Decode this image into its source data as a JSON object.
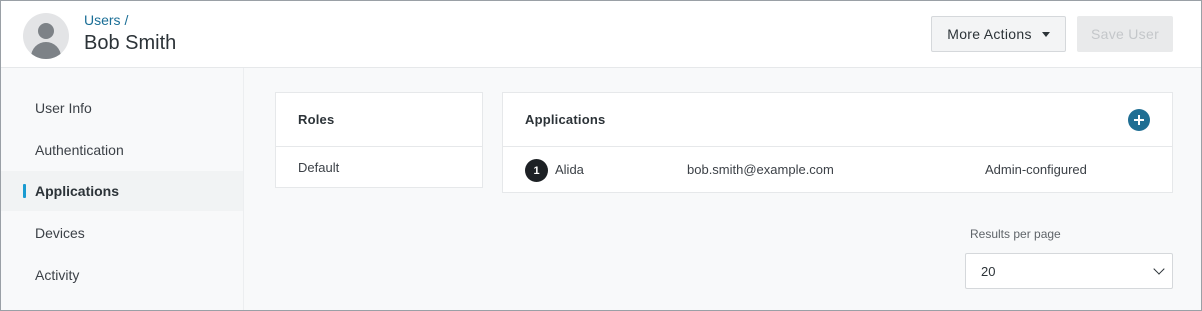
{
  "header": {
    "breadcrumb": "Users",
    "breadcrumb_separator": "/",
    "title": "Bob Smith",
    "more_actions_label": "More Actions",
    "save_label": "Save User",
    "avatar_icon": "user-avatar-icon"
  },
  "sidebar": {
    "items": [
      {
        "label": "User Info",
        "active": false
      },
      {
        "label": "Authentication",
        "active": false
      },
      {
        "label": "Applications",
        "active": true
      },
      {
        "label": "Devices",
        "active": false
      },
      {
        "label": "Activity",
        "active": false
      }
    ]
  },
  "roles": {
    "title": "Roles",
    "items": [
      "Default"
    ]
  },
  "applications": {
    "title": "Applications",
    "add_icon": "plus-icon",
    "rows": [
      {
        "badge": "1",
        "name": "Alida",
        "email": "bob.smith@example.com",
        "type": "Admin-configured"
      }
    ]
  },
  "pagination": {
    "label": "Results per page",
    "value": "20"
  },
  "colors": {
    "link": "#1a6e96",
    "accent": "#1a9bd1",
    "add_button": "#1f6e93"
  }
}
